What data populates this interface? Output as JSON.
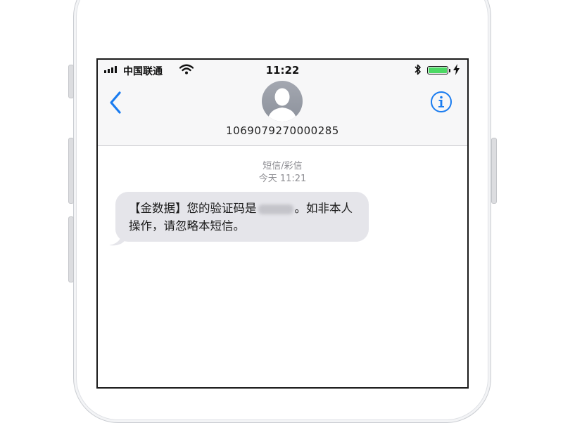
{
  "status_bar": {
    "carrier": "中国联通",
    "time": "11:22",
    "battery_color": "#4cd964"
  },
  "header": {
    "contact_number": "1069079270000285",
    "back_icon": "chevron-left-icon",
    "info_icon": "info-circle-icon",
    "avatar_icon": "default-person-avatar"
  },
  "conversation": {
    "message_type": "短信/彩信",
    "timestamp": "今天 11:21",
    "message_before_code": "【金数据】您的验证码是",
    "message_after_code": "。如非本人操作，请忽略本短信。"
  },
  "colors": {
    "accent": "#1a7cf0",
    "bubble": "#e5e5ea",
    "meta_text": "#8e8e93"
  }
}
